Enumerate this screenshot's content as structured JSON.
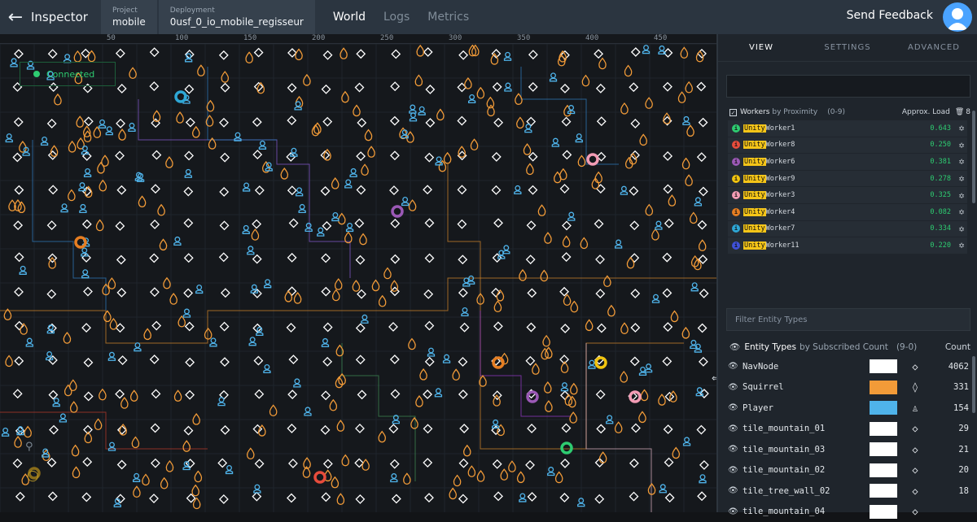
{
  "topbar": {
    "title": "Inspector",
    "project_label": "Project",
    "project_value": "mobile",
    "deployment_label": "Deployment",
    "deployment_value": "0usf_0_io_mobile_regisseur",
    "nav": [
      "World",
      "Logs",
      "Metrics"
    ],
    "active_nav": "World",
    "feedback": "Send Feedback"
  },
  "map": {
    "ruler_ticks": [
      "50",
      "100",
      "150",
      "200",
      "250",
      "300",
      "350",
      "400",
      "450"
    ],
    "status": "Connected",
    "colors": {
      "navnode": "#ffffff",
      "squirrel": "#f29b38",
      "player": "#4fb3ea"
    }
  },
  "panel": {
    "tabs": [
      "VIEW",
      "SETTINGS",
      "ADVANCED"
    ],
    "active_tab": "VIEW",
    "workers": {
      "title": "Workers",
      "by": "by Proximity",
      "range": "(0-9)",
      "load_label": "Approx. Load",
      "count": "8",
      "items": [
        {
          "prefix": "Unity",
          "name": "Worker1",
          "load": "0.643",
          "color": "#2ecc71"
        },
        {
          "prefix": "Unity",
          "name": "Worker8",
          "load": "0.250",
          "color": "#e74c3c"
        },
        {
          "prefix": "Unity",
          "name": "Worker6",
          "load": "0.381",
          "color": "#9b59b6"
        },
        {
          "prefix": "Unity",
          "name": "Worker9",
          "load": "0.278",
          "color": "#f1c40f"
        },
        {
          "prefix": "Unity",
          "name": "Worker3",
          "load": "0.325",
          "color": "#f39cb5"
        },
        {
          "prefix": "Unity",
          "name": "Worker4",
          "load": "0.082",
          "color": "#e67e22"
        },
        {
          "prefix": "Unity",
          "name": "Worker7",
          "load": "0.334",
          "color": "#2ea7d6"
        },
        {
          "prefix": "Unity",
          "name": "Worker11",
          "load": "0.220",
          "color": "#3f51d8"
        }
      ]
    },
    "filter_placeholder": "Filter Entity Types",
    "entities": {
      "title": "Entity Types",
      "by": "by Subscribed Count",
      "range": "(9-0)",
      "count_label": "Count",
      "items": [
        {
          "name": "NavNode",
          "count": "4062",
          "color": "#ffffff",
          "glyph": "◇"
        },
        {
          "name": "Squirrel",
          "count": "331",
          "color": "#f29b38",
          "glyph": "◊"
        },
        {
          "name": "Player",
          "count": "154",
          "color": "#4fb3ea",
          "glyph": "♙"
        },
        {
          "name": "tile_mountain_01",
          "count": "29",
          "color": "#ffffff",
          "glyph": "◇"
        },
        {
          "name": "tile_mountain_03",
          "count": "21",
          "color": "#ffffff",
          "glyph": "◇"
        },
        {
          "name": "tile_mountain_02",
          "count": "20",
          "color": "#ffffff",
          "glyph": "◇"
        },
        {
          "name": "tile_tree_wall_02",
          "count": "18",
          "color": "#ffffff",
          "glyph": "◇"
        },
        {
          "name": "tile_mountain_04",
          "count": "",
          "color": "#ffffff",
          "glyph": "◇"
        }
      ]
    }
  }
}
